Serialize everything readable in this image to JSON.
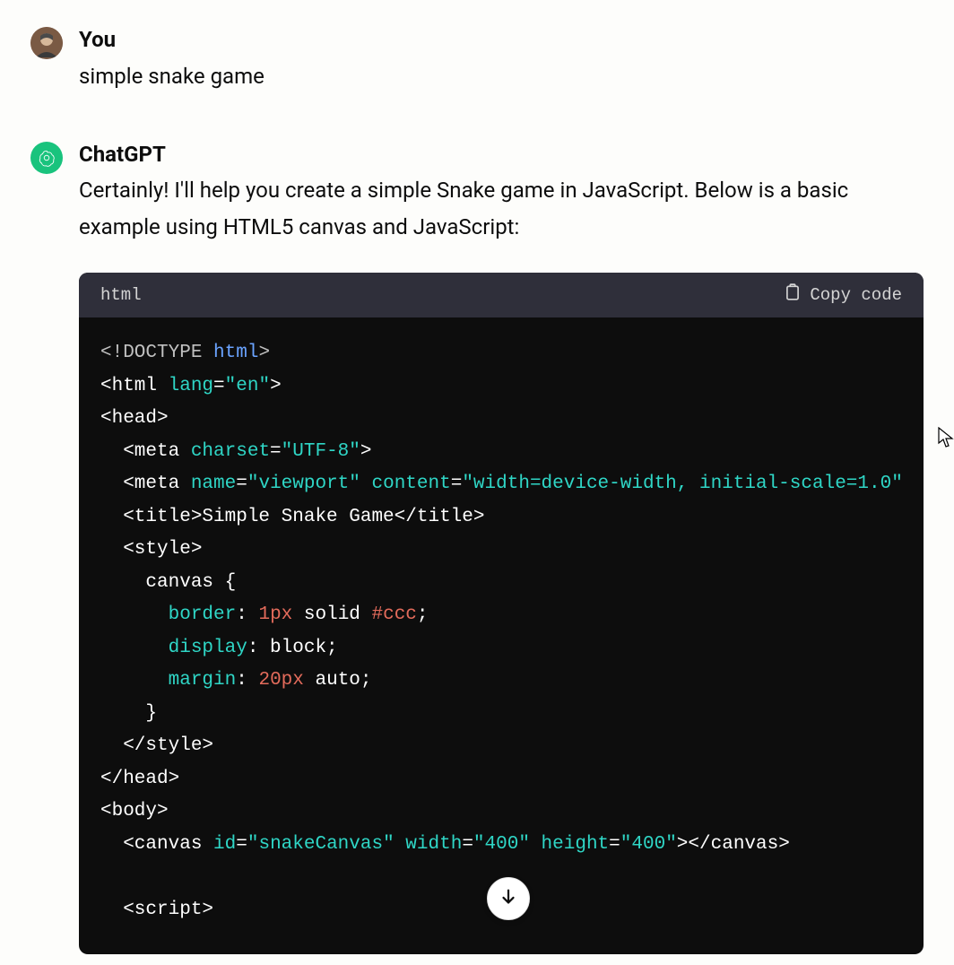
{
  "user": {
    "sender": "You",
    "text": "simple snake game"
  },
  "assistant": {
    "sender": "ChatGPT",
    "text": "Certainly! I'll help you create a simple Snake game in JavaScript. Below is a basic example using HTML5 canvas and JavaScript:",
    "code": {
      "language": "html",
      "copy_label": "Copy code",
      "tokens": [
        {
          "t": "<!DOCTYPE ",
          "c": "tk-doctype"
        },
        {
          "t": "html",
          "c": "tk-htmlkw"
        },
        {
          "t": ">",
          "c": "tk-doctype"
        },
        {
          "t": "\n"
        },
        {
          "t": "<html ",
          "c": "tk-tag"
        },
        {
          "t": "lang",
          "c": "tk-attr"
        },
        {
          "t": "=",
          "c": "tk-tag"
        },
        {
          "t": "\"en\"",
          "c": "tk-string"
        },
        {
          "t": ">",
          "c": "tk-tag"
        },
        {
          "t": "\n"
        },
        {
          "t": "<head>",
          "c": "tk-tag"
        },
        {
          "t": "\n"
        },
        {
          "t": "  <meta ",
          "c": "tk-tag"
        },
        {
          "t": "charset",
          "c": "tk-attr"
        },
        {
          "t": "=",
          "c": "tk-tag"
        },
        {
          "t": "\"UTF-8\"",
          "c": "tk-string"
        },
        {
          "t": ">",
          "c": "tk-tag"
        },
        {
          "t": "\n"
        },
        {
          "t": "  <meta ",
          "c": "tk-tag"
        },
        {
          "t": "name",
          "c": "tk-attr"
        },
        {
          "t": "=",
          "c": "tk-tag"
        },
        {
          "t": "\"viewport\"",
          "c": "tk-string"
        },
        {
          "t": " ",
          "c": "tk-tag"
        },
        {
          "t": "content",
          "c": "tk-attr"
        },
        {
          "t": "=",
          "c": "tk-tag"
        },
        {
          "t": "\"width=device-width, initial-scale=1.0\"",
          "c": "tk-string"
        },
        {
          "t": "\n"
        },
        {
          "t": "  <title>",
          "c": "tk-tag"
        },
        {
          "t": "Simple Snake Game",
          "c": "tk-plain"
        },
        {
          "t": "</title>",
          "c": "tk-tag"
        },
        {
          "t": "\n"
        },
        {
          "t": "  <style>",
          "c": "tk-tag"
        },
        {
          "t": "\n"
        },
        {
          "t": "    canvas {",
          "c": "tk-plain"
        },
        {
          "t": "\n"
        },
        {
          "t": "      ",
          "c": "tk-plain"
        },
        {
          "t": "border",
          "c": "tk-prop"
        },
        {
          "t": ": ",
          "c": "tk-punct"
        },
        {
          "t": "1px",
          "c": "tk-num"
        },
        {
          "t": " solid ",
          "c": "tk-plain"
        },
        {
          "t": "#ccc",
          "c": "tk-hex"
        },
        {
          "t": ";",
          "c": "tk-punct"
        },
        {
          "t": "\n"
        },
        {
          "t": "      ",
          "c": "tk-plain"
        },
        {
          "t": "display",
          "c": "tk-prop"
        },
        {
          "t": ": block;",
          "c": "tk-punct"
        },
        {
          "t": "\n"
        },
        {
          "t": "      ",
          "c": "tk-plain"
        },
        {
          "t": "margin",
          "c": "tk-prop"
        },
        {
          "t": ": ",
          "c": "tk-punct"
        },
        {
          "t": "20px",
          "c": "tk-num"
        },
        {
          "t": " auto;",
          "c": "tk-punct"
        },
        {
          "t": "\n"
        },
        {
          "t": "    }",
          "c": "tk-plain"
        },
        {
          "t": "\n"
        },
        {
          "t": "  </style>",
          "c": "tk-tag"
        },
        {
          "t": "\n"
        },
        {
          "t": "</head>",
          "c": "tk-tag"
        },
        {
          "t": "\n"
        },
        {
          "t": "<body>",
          "c": "tk-tag"
        },
        {
          "t": "\n"
        },
        {
          "t": "  <canvas ",
          "c": "tk-tag"
        },
        {
          "t": "id",
          "c": "tk-attr"
        },
        {
          "t": "=",
          "c": "tk-tag"
        },
        {
          "t": "\"snakeCanvas\"",
          "c": "tk-string"
        },
        {
          "t": " ",
          "c": "tk-tag"
        },
        {
          "t": "width",
          "c": "tk-attr"
        },
        {
          "t": "=",
          "c": "tk-tag"
        },
        {
          "t": "\"400\"",
          "c": "tk-string"
        },
        {
          "t": " ",
          "c": "tk-tag"
        },
        {
          "t": "height",
          "c": "tk-attr"
        },
        {
          "t": "=",
          "c": "tk-tag"
        },
        {
          "t": "\"400\"",
          "c": "tk-string"
        },
        {
          "t": ">",
          "c": "tk-tag"
        },
        {
          "t": "</canvas>",
          "c": "tk-tag"
        },
        {
          "t": "\n"
        },
        {
          "t": "\n"
        },
        {
          "t": "  <script>",
          "c": "tk-tag"
        }
      ]
    }
  }
}
